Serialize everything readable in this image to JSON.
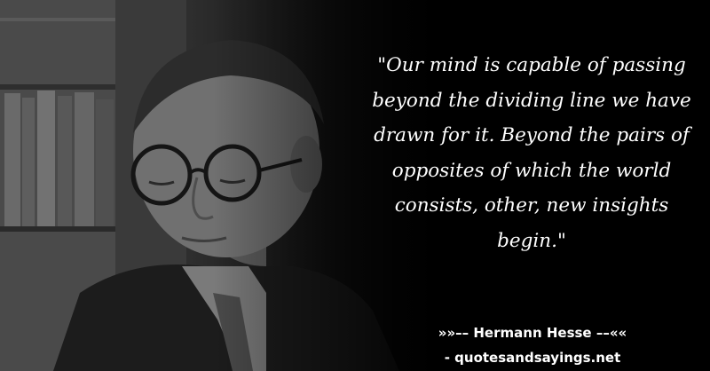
{
  "quote": {
    "text": "\"Our mind is capable of passing beyond the dividing line we have drawn for it. Beyond the pairs of opposites of which the world consists, other, new insights begin.\""
  },
  "attribution": {
    "author_line": "»»–– Hermann Hesse ––««",
    "source_line": "- quotesandsayings.net"
  },
  "colors": {
    "background": "#000000",
    "text": "#ffffff"
  },
  "image": {
    "description_icon": "portrait-photo"
  }
}
